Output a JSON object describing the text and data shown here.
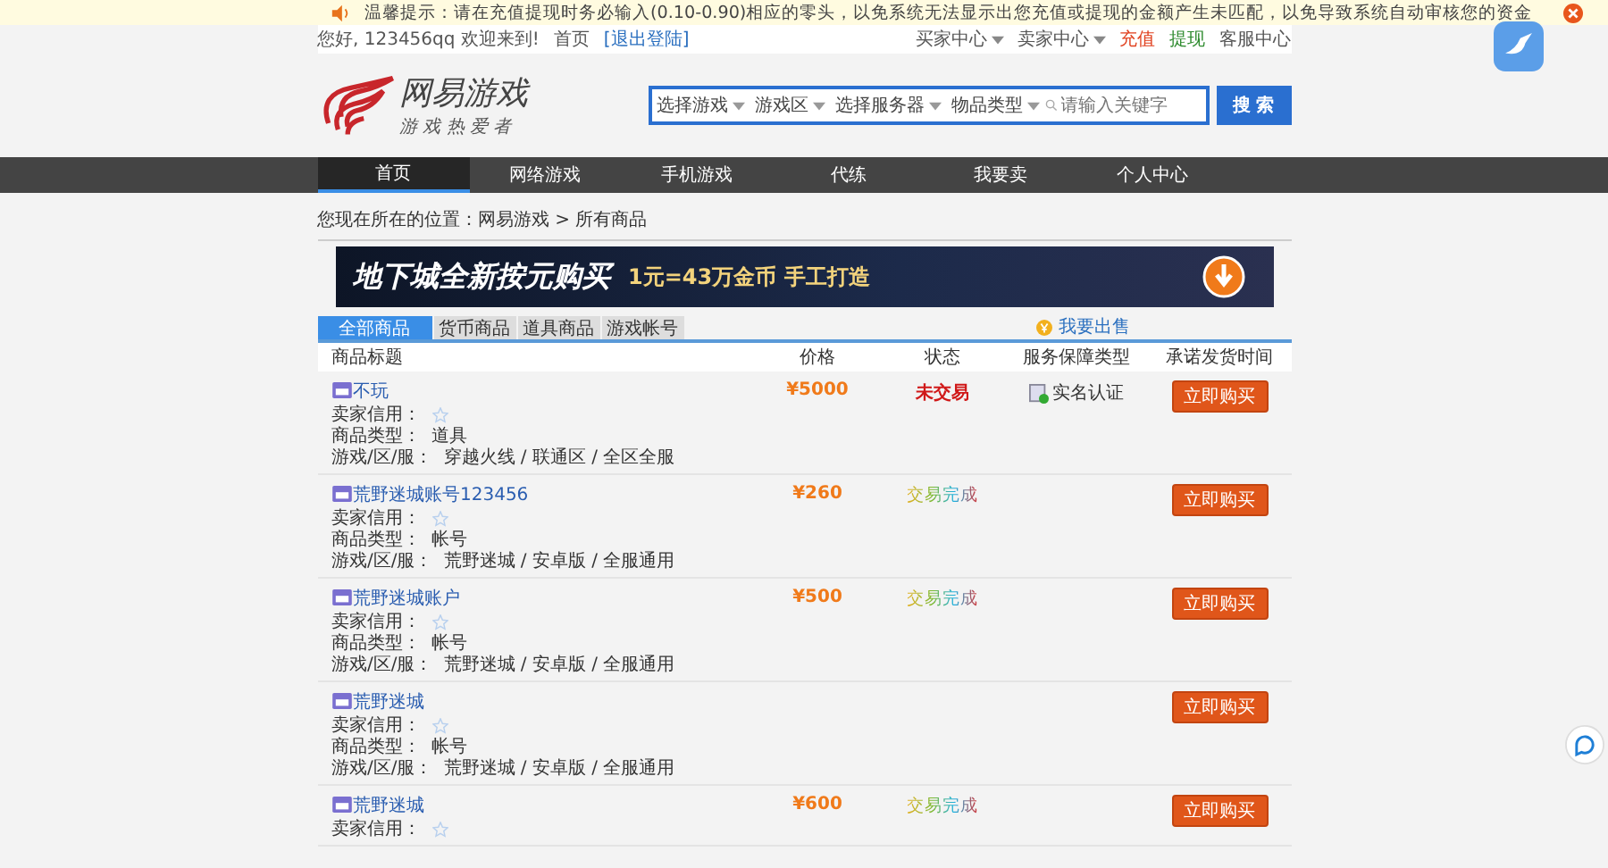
{
  "notice": {
    "text": "温馨提示：请在充值提现时务必输入(0.10-0.90)相应的零头，以免系统无法显示出您充值或提现的金额产生未匹配，以免导致系统自动审核您的资金"
  },
  "topbar": {
    "greeting": "您好, 123456qq 欢迎来到!",
    "home": "首页",
    "logout": "[退出登陆]",
    "links": [
      {
        "label": "买家中心",
        "dropdown": true,
        "color": "#555555"
      },
      {
        "label": "卖家中心",
        "dropdown": true,
        "color": "#555555"
      },
      {
        "label": "充值",
        "dropdown": false,
        "color": "#e0401e"
      },
      {
        "label": "提现",
        "dropdown": false,
        "color": "#2e8b2e"
      },
      {
        "label": "客服中心",
        "dropdown": false,
        "color": "#555555"
      }
    ]
  },
  "logo": {
    "name": "网易游戏",
    "slogan": "游 戏 热 爱 者"
  },
  "search": {
    "selects": [
      "选择游戏",
      "游戏区",
      "选择服务器",
      "物品类型"
    ],
    "placeholder": "请输入关键字",
    "button": "搜 索"
  },
  "nav": [
    {
      "label": "首页",
      "selected": true
    },
    {
      "label": "网络游戏",
      "selected": false
    },
    {
      "label": "手机游戏",
      "selected": false
    },
    {
      "label": "代练",
      "selected": false
    },
    {
      "label": "我要卖",
      "selected": false
    },
    {
      "label": "个人中心",
      "selected": false
    }
  ],
  "breadcrumb": "您现在所在的位置：网易游戏 > 所有商品",
  "banner": {
    "headline": "地下城全新按元购买",
    "offer": "1元=43万金币  手工打造"
  },
  "tabs": [
    {
      "label": "全部商品",
      "selected": true
    },
    {
      "label": "货币商品",
      "selected": false
    },
    {
      "label": "道具商品",
      "selected": false
    },
    {
      "label": "游戏帐号",
      "selected": false
    }
  ],
  "sell_link": "我要出售",
  "table": {
    "columns": [
      "商品标题",
      "价格",
      "状态",
      "服务保障类型",
      "承诺发货时间"
    ],
    "rows": [
      {
        "title": "不玩",
        "price": "¥5000",
        "status": {
          "kind": "pending",
          "text": "未交易"
        },
        "service": "实名认证",
        "button": "立即购买",
        "credit_label": "卖家信用：",
        "details": [
          {
            "label": "商品类型：",
            "value": "道具"
          },
          {
            "label": "游戏/区/服：",
            "value": "穿越火线 / 联通区 / 全区全服"
          }
        ]
      },
      {
        "title": "荒野迷城账号123456",
        "price": "¥260",
        "status": {
          "kind": "done",
          "text": "交易完成"
        },
        "button": "立即购买",
        "credit_label": "卖家信用：",
        "details": [
          {
            "label": "商品类型：",
            "value": "帐号"
          },
          {
            "label": "游戏/区/服：",
            "value": "荒野迷城 / 安卓版 / 全服通用"
          }
        ]
      },
      {
        "title": "荒野迷城账户",
        "price": "¥500",
        "status": {
          "kind": "done",
          "text": "交易完成"
        },
        "button": "立即购买",
        "credit_label": "卖家信用：",
        "details": [
          {
            "label": "商品类型：",
            "value": "帐号"
          },
          {
            "label": "游戏/区/服：",
            "value": "荒野迷城 / 安卓版 / 全服通用"
          }
        ]
      },
      {
        "title": "荒野迷城",
        "button": "立即购买",
        "credit_label": "卖家信用：",
        "details": [
          {
            "label": "商品类型：",
            "value": "帐号"
          },
          {
            "label": "游戏/区/服：",
            "value": "荒野迷城 / 安卓版 / 全服通用"
          }
        ]
      },
      {
        "title": "荒野迷城",
        "price": "¥600",
        "status": {
          "kind": "done",
          "text": "交易完成"
        },
        "button": "立即购买",
        "credit_label": "卖家信用："
      }
    ]
  }
}
